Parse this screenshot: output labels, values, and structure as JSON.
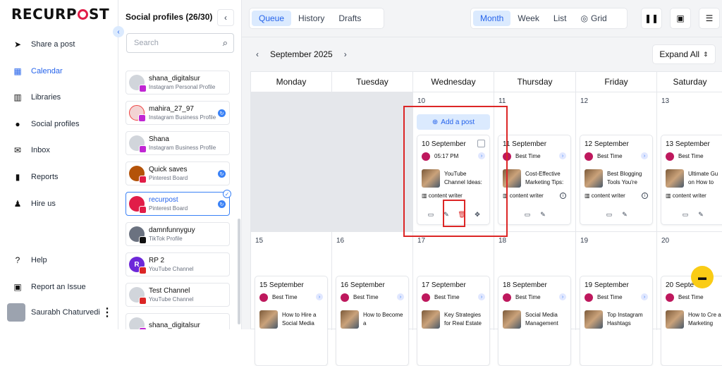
{
  "logo": {
    "pre": "RECURP",
    "post": "ST"
  },
  "nav": {
    "items": [
      {
        "label": "Share a post",
        "icon": "send-icon"
      },
      {
        "label": "Calendar",
        "icon": "calendar-icon"
      },
      {
        "label": "Libraries",
        "icon": "library-icon"
      },
      {
        "label": "Social profiles",
        "icon": "user-circle-icon"
      },
      {
        "label": "Inbox",
        "icon": "inbox-icon"
      },
      {
        "label": "Reports",
        "icon": "reports-icon"
      },
      {
        "label": "Hire us",
        "icon": "person-icon"
      },
      {
        "label": "Help",
        "icon": "help-icon"
      },
      {
        "label": "Report an Issue",
        "icon": "report-icon"
      }
    ],
    "user_name": "Saurabh Chaturvedi"
  },
  "profiles": {
    "title": "Social profiles (26/30)",
    "search_placeholder": "Search",
    "items": [
      {
        "name": "shana_digitalsur",
        "type": "Instagram Personal Profile",
        "badge_color": "#c026d3"
      },
      {
        "name": "mahira_27_97",
        "type": "Instagram Business Profile",
        "badge_color": "#c026d3"
      },
      {
        "name": "Shana",
        "type": "Instagram Business Profile",
        "badge_color": "#c026d3"
      },
      {
        "name": "Quick saves",
        "type": "Pinterest Board",
        "badge_color": "#e11d48"
      },
      {
        "name": "recurpost",
        "type": "Pinterest Board",
        "badge_color": "#e11d48"
      },
      {
        "name": "damnfunnyguy",
        "type": "TikTok Profile",
        "badge_color": "#111111"
      },
      {
        "name": "RP 2",
        "type": "YouTube Channel",
        "badge_color": "#dc2626",
        "avatar_text": "R"
      },
      {
        "name": "Test Channel",
        "type": "YouTube Channel",
        "badge_color": "#dc2626"
      },
      {
        "name": "shana_digitalsur",
        "type": "",
        "badge_color": "#c026d3"
      }
    ]
  },
  "toolbar": {
    "view_tabs": [
      "Queue",
      "History",
      "Drafts"
    ],
    "mode_tabs": [
      "Month",
      "Week",
      "List",
      "Grid"
    ],
    "month_label": "September 2025",
    "expand_label": "Expand All"
  },
  "calendar": {
    "days": [
      "Monday",
      "Tuesday",
      "Wednesday",
      "Thursday",
      "Friday",
      "Saturday"
    ],
    "week1_nums": [
      "10",
      "11",
      "12",
      "13"
    ],
    "week2_nums": [
      "15",
      "16",
      "17",
      "18",
      "19",
      "20"
    ],
    "add_post": "Add a post",
    "best_time": "Best Time",
    "lib_label": "content writer",
    "week1_posts": [
      {
        "date": "10 September",
        "time": "05:17 PM",
        "text": "YouTube Channel Ideas:"
      },
      {
        "date": "11 September",
        "time": "Best Time",
        "text": "Cost-Effective Marketing Tips:"
      },
      {
        "date": "12 September",
        "time": "Best Time",
        "text": "Best Blogging Tools You're"
      },
      {
        "date": "13 September",
        "time": "Best Time",
        "text": "Ultimate Gu on How to"
      }
    ],
    "week2_posts": [
      {
        "date": "15 September",
        "text": "How to Hire a Social Media"
      },
      {
        "date": "16 September",
        "text": "How to Become a"
      },
      {
        "date": "17 September",
        "text": "Key Strategies for Real Estate"
      },
      {
        "date": "18 September",
        "text": "Social Media Management"
      },
      {
        "date": "19 September",
        "text": "Top Instagram Hashtags"
      },
      {
        "date": "20 Septe",
        "text": "How to Cre a Marketing"
      }
    ]
  }
}
